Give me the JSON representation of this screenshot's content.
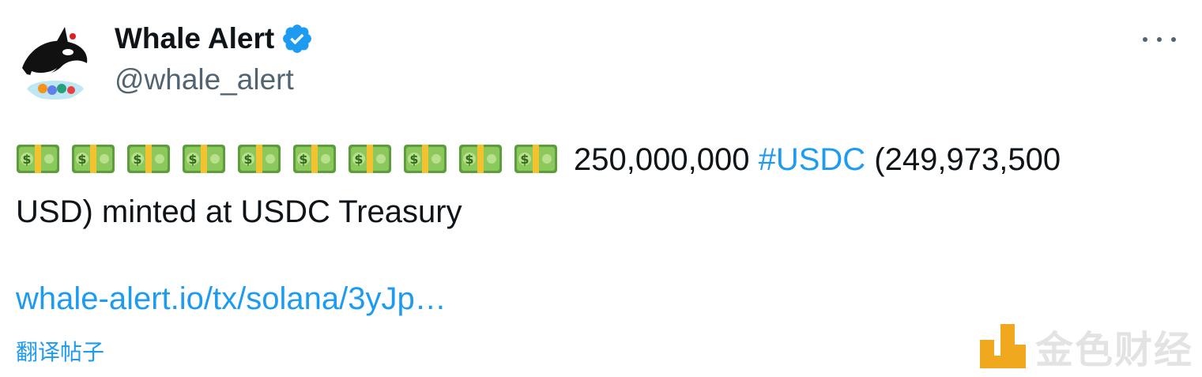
{
  "author": {
    "display_name": "Whale Alert",
    "handle": "@whale_alert",
    "verified": true,
    "avatar_icon": "orca-whale-avatar",
    "verified_icon": "verified-badge-icon",
    "verified_color": "#1d9bf0"
  },
  "menu": {
    "icon": "more-options-icon"
  },
  "tweet": {
    "emoji_icon": "money-with-wings-banknote-icon",
    "emoji_count": 10,
    "amount_text": "250,000,000",
    "hashtag": "#USDC",
    "usd_value_text": "(249,973,500",
    "rest_text": "USD) minted at USDC Treasury",
    "link_text": "whale-alert.io/tx/solana/3yJp…",
    "translate_label": "翻译帖子",
    "accent_color": "#1d9bf0"
  },
  "watermark": {
    "text": "金色财经",
    "logo_icon": "jinse-logo-icon",
    "logo_color": "#f0a81e"
  }
}
